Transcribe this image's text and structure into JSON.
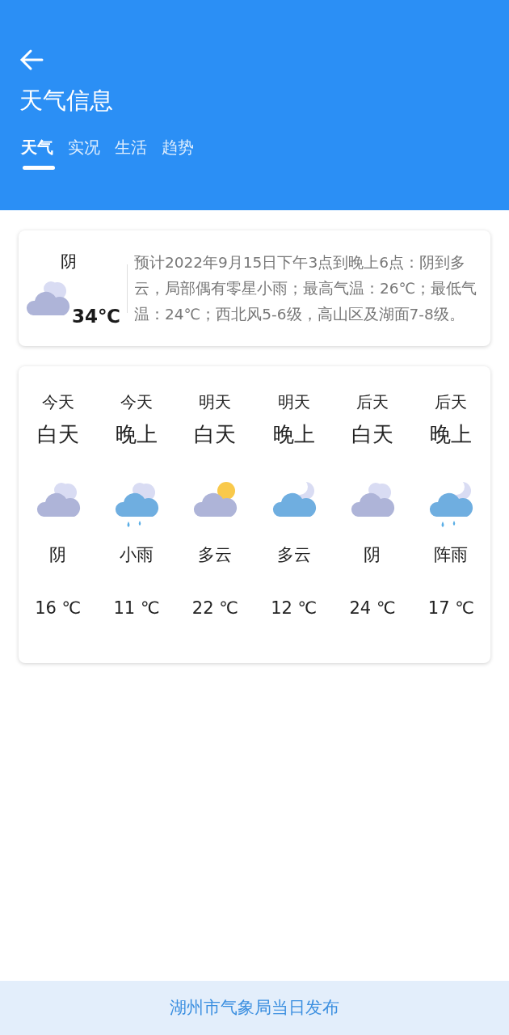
{
  "header": {
    "title": "天气信息"
  },
  "tabs": [
    {
      "label": "天气",
      "selected": true
    },
    {
      "label": "实况",
      "selected": false
    },
    {
      "label": "生活",
      "selected": false
    },
    {
      "label": "趋势",
      "selected": false
    }
  ],
  "current": {
    "condition": "阴",
    "kind": "overcast",
    "temperature": "34℃",
    "forecast": "预计2022年9月15日下午3点到晚上6点：阴到多云，局部偶有零星小雨；最高气温：26℃；最低气温：24℃；西北风5-6级，高山区及湖面7-8级。"
  },
  "periods": [
    {
      "day": "今天",
      "part": "白天",
      "kind": "overcast",
      "condition": "阴",
      "temperature": "16 ℃"
    },
    {
      "day": "今天",
      "part": "晚上",
      "kind": "rain",
      "condition": "小雨",
      "temperature": "11 ℃"
    },
    {
      "day": "明天",
      "part": "白天",
      "kind": "partly-sunny",
      "condition": "多云",
      "temperature": "22 ℃"
    },
    {
      "day": "明天",
      "part": "晚上",
      "kind": "cloudy-night",
      "condition": "多云",
      "temperature": "12 ℃"
    },
    {
      "day": "后天",
      "part": "白天",
      "kind": "overcast",
      "condition": "阴",
      "temperature": "24 ℃"
    },
    {
      "day": "后天",
      "part": "晚上",
      "kind": "shower-night",
      "condition": "阵雨",
      "temperature": "17 ℃"
    }
  ],
  "footer": "湖州市气象局当日发布"
}
